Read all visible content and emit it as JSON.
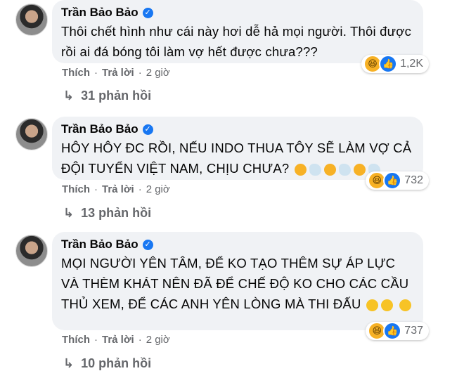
{
  "comments": [
    {
      "author": "Trần Bảo Bảo",
      "text": "Thôi chết hình như cái này hơi dễ hả mọi người. Thôi được rồi ai đá bóng tôi làm vợ hết được chưa???",
      "reaction_count": "1,2K",
      "like_label": "Thích",
      "reply_label": "Trả lời",
      "time": "2 giờ",
      "replies_label": "31 phản hồi"
    },
    {
      "author": "Trần Bảo Bảo",
      "text": "HÔY HÔY ĐC RỒI, NẾU INDO THUA TÔY SẼ LÀM VỢ CẢ ĐỘI TUYỂN VIỆT NAM, CHỊU CHƯA?",
      "emoji_tail": [
        "astonished-face",
        "dash-symbol",
        "astonished-face",
        "dash-symbol",
        "astonished-face",
        "dash-symbol"
      ],
      "reaction_count": "732",
      "like_label": "Thích",
      "reply_label": "Trả lời",
      "time": "2 giờ",
      "replies_label": "13 phản hồi"
    },
    {
      "author": "Trần Bảo Bảo",
      "text": "MỌI NGƯỜI YÊN TÂM, ĐỂ KO TẠO THÊM SỰ ÁP LỰC VÀ THÈM KHÁT NÊN ĐÃ ĐỂ CHẾ ĐỘ KO CHO CÁC CẦU THỦ XEM, ĐỂ CÁC ANH YÊN LÒNG MÀ THI ĐẤU",
      "emoji_tail": [
        "rolling-laughing-face",
        "rolling-laughing-face",
        "rolling-laughing-face"
      ],
      "reaction_count": "737",
      "like_label": "Thích",
      "reply_label": "Trả lời",
      "time": "2 giờ",
      "replies_label": "10 phản hồi"
    }
  ],
  "colors": {
    "bubble": "#f0f2f5",
    "meta": "#65676b",
    "verified": "#1877f2",
    "haha": "#f7b125"
  },
  "icons": {
    "verified": "verified-badge-icon",
    "haha": "haha-reaction-icon",
    "like": "like-reaction-icon",
    "reply_arrow": "reply-arrow-icon"
  }
}
